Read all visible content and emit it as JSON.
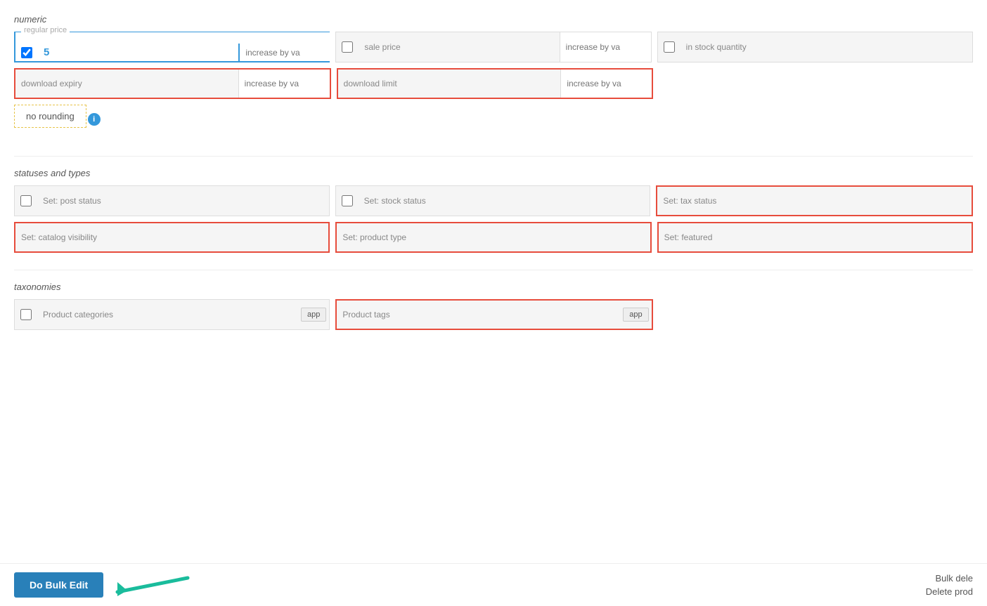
{
  "sections": {
    "numeric": {
      "label": "numeric",
      "fields_row1": [
        {
          "id": "regular-price",
          "label": "regular price",
          "has_checkbox": true,
          "checked": true,
          "value": "5",
          "increase_placeholder": "increase by va",
          "border": "blue-active"
        },
        {
          "id": "sale-price",
          "label": "sale price",
          "has_checkbox": true,
          "checked": false,
          "value": "",
          "increase_placeholder": "increase by va",
          "border": "normal"
        },
        {
          "id": "in-stock-quantity",
          "label": "in stock quantity",
          "has_checkbox": true,
          "checked": false,
          "value": "",
          "increase_placeholder": "",
          "border": "normal",
          "no_increase": true
        }
      ],
      "fields_row2": [
        {
          "id": "download-expiry",
          "label": "download expiry",
          "has_checkbox": false,
          "value": "",
          "increase_placeholder": "increase by va",
          "border": "red-border"
        },
        {
          "id": "download-limit",
          "label": "download limit",
          "has_checkbox": false,
          "value": "",
          "increase_placeholder": "increase by va",
          "border": "red-border"
        }
      ],
      "no_rounding": "no rounding",
      "info_icon": "i"
    },
    "statuses": {
      "label": "statuses and types",
      "fields_row1": [
        {
          "id": "post-status",
          "label": "Set: post status",
          "has_checkbox": true,
          "checked": false,
          "border": "normal"
        },
        {
          "id": "stock-status",
          "label": "Set: stock status",
          "has_checkbox": true,
          "checked": false,
          "border": "normal"
        },
        {
          "id": "tax-status",
          "label": "Set: tax status",
          "has_checkbox": false,
          "border": "red-border"
        }
      ],
      "fields_row2": [
        {
          "id": "catalog-visibility",
          "label": "Set: catalog visibility",
          "has_checkbox": false,
          "border": "red-border"
        },
        {
          "id": "product-type",
          "label": "Set: product type",
          "has_checkbox": false,
          "border": "red-border"
        },
        {
          "id": "featured",
          "label": "Set: featured",
          "has_checkbox": false,
          "border": "red-border"
        }
      ]
    },
    "taxonomies": {
      "label": "taxonomies",
      "fields_row1": [
        {
          "id": "product-categories",
          "label": "Product categories",
          "has_checkbox": true,
          "checked": false,
          "has_app_btn": true,
          "app_label": "app",
          "border": "normal"
        },
        {
          "id": "product-tags",
          "label": "Product tags",
          "has_checkbox": false,
          "has_app_btn": true,
          "app_label": "app",
          "border": "red-border"
        }
      ]
    }
  },
  "bottom": {
    "do_bulk_edit_label": "Do Bulk Edit",
    "bulk_delete_label": "Bulk dele",
    "delete_product_label": "Delete prod"
  }
}
